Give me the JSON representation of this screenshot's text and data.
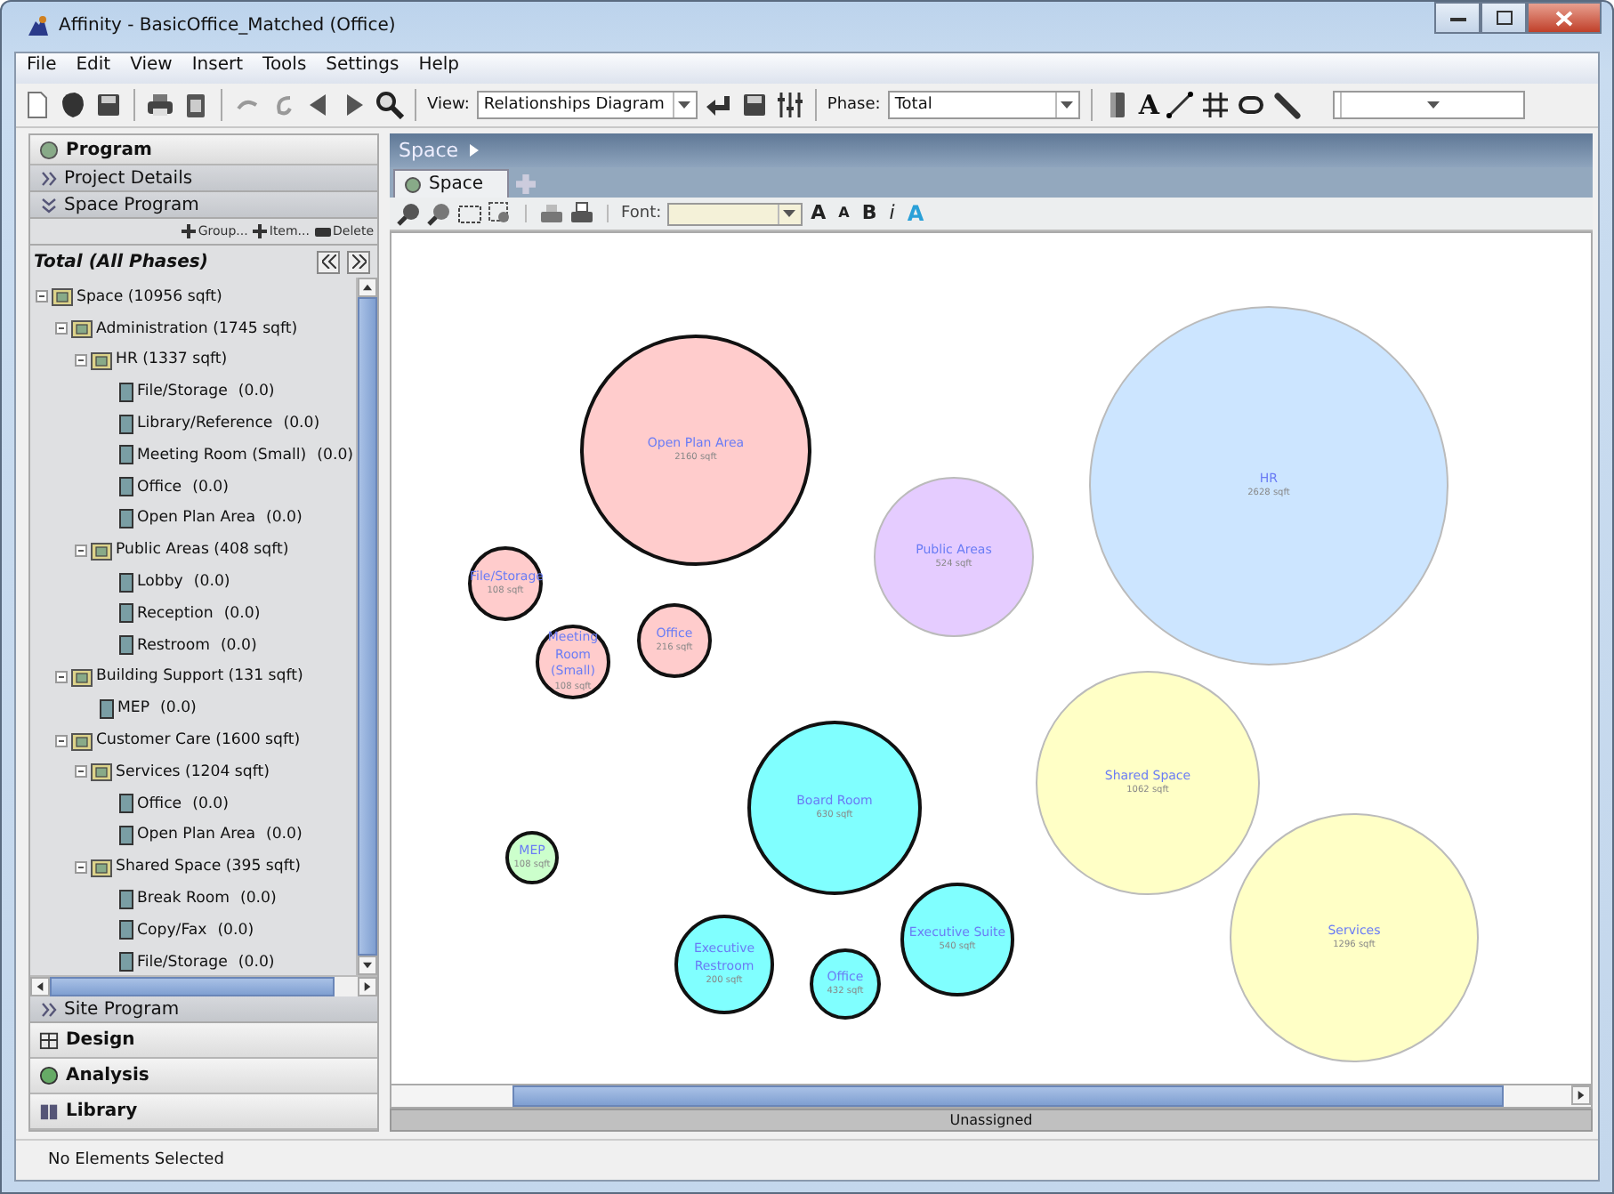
{
  "window": {
    "title": "Affinity - BasicOffice_Matched (Office)"
  },
  "menu": [
    "File",
    "Edit",
    "View",
    "Insert",
    "Tools",
    "Settings",
    "Help"
  ],
  "toolbar": {
    "view_label": "View:",
    "view_value": "Relationships Diagram",
    "phase_label": "Phase:",
    "phase_value": "Total",
    "text_tool": "A"
  },
  "program_panel": {
    "title": "Program",
    "subsections": [
      {
        "title": "Project Details",
        "expanded": false
      },
      {
        "title": "Space Program",
        "expanded": true
      }
    ],
    "actions": [
      "Group...",
      "Item...",
      "Delete"
    ],
    "filter_title": "Total (All Phases)",
    "tree": [
      {
        "label": "Space (10956 sqft)",
        "kind": "group",
        "expanded": true,
        "children": [
          {
            "label": "Administration (1745 sqft)",
            "kind": "group",
            "expanded": true,
            "children": [
              {
                "label": "HR (1337 sqft)",
                "kind": "group",
                "expanded": true,
                "children": [
                  {
                    "label": "File/Storage",
                    "value": "(0.0)",
                    "kind": "space"
                  },
                  {
                    "label": "Library/Reference",
                    "value": "(0.0)",
                    "kind": "space"
                  },
                  {
                    "label": "Meeting Room (Small)",
                    "value": "(0.0)",
                    "kind": "space"
                  },
                  {
                    "label": "Office",
                    "value": "(0.0)",
                    "kind": "space"
                  },
                  {
                    "label": "Open Plan Area",
                    "value": "(0.0)",
                    "kind": "space"
                  }
                ]
              },
              {
                "label": "Public Areas (408 sqft)",
                "kind": "group",
                "expanded": true,
                "children": [
                  {
                    "label": "Lobby",
                    "value": "(0.0)",
                    "kind": "space"
                  },
                  {
                    "label": "Reception",
                    "value": "(0.0)",
                    "kind": "space"
                  },
                  {
                    "label": "Restroom",
                    "value": "(0.0)",
                    "kind": "space"
                  }
                ]
              }
            ]
          },
          {
            "label": "Building Support (131 sqft)",
            "kind": "group",
            "expanded": true,
            "children": [
              {
                "label": "MEP",
                "value": "(0.0)",
                "kind": "space"
              }
            ]
          },
          {
            "label": "Customer Care (1600 sqft)",
            "kind": "group",
            "expanded": true,
            "children": [
              {
                "label": "Services (1204 sqft)",
                "kind": "group",
                "expanded": true,
                "children": [
                  {
                    "label": "Office",
                    "value": "(0.0)",
                    "kind": "space"
                  },
                  {
                    "label": "Open Plan Area",
                    "value": "(0.0)",
                    "kind": "space"
                  }
                ]
              },
              {
                "label": "Shared Space (395 sqft)",
                "kind": "group",
                "expanded": true,
                "children": [
                  {
                    "label": "Break Room",
                    "value": "(0.0)",
                    "kind": "space"
                  },
                  {
                    "label": "Copy/Fax",
                    "value": "(0.0)",
                    "kind": "space"
                  },
                  {
                    "label": "File/Storage",
                    "value": "(0.0)",
                    "kind": "space"
                  }
                ]
              }
            ]
          }
        ]
      }
    ],
    "site_program": {
      "title": "Site Program",
      "expanded": false
    }
  },
  "panels": [
    {
      "title": "Design"
    },
    {
      "title": "Analysis"
    },
    {
      "title": "Library"
    }
  ],
  "diagram": {
    "breadcrumb": "Space",
    "tabs": [
      {
        "label": "Space",
        "selected": true
      }
    ],
    "font_label": "Font:",
    "format_buttons": [
      {
        "label": "A",
        "kind": "grow"
      },
      {
        "label": "A",
        "kind": "shrink"
      },
      {
        "label": "B",
        "kind": "bold"
      },
      {
        "label": "i",
        "kind": "italic"
      },
      {
        "label": "A",
        "kind": "color"
      }
    ],
    "bubbles": [
      {
        "name": "Open Plan Area",
        "area": "2160 sqft",
        "color": "#ffcccc",
        "outlined": true
      },
      {
        "name": "File/Storage",
        "area": "108 sqft",
        "color": "#ffcccc",
        "outlined": true
      },
      {
        "name": "Meeting Room (Small)",
        "area": "108 sqft",
        "color": "#ffcccc",
        "outlined": true
      },
      {
        "name": "Office",
        "area": "216 sqft",
        "color": "#ffcccc",
        "outlined": true
      },
      {
        "name": "Public Areas",
        "area": "524 sqft",
        "color": "#e5ccff",
        "outlined": false
      },
      {
        "name": "HR",
        "area": "2628 sqft",
        "color": "#cce5ff",
        "outlined": false
      },
      {
        "name": "Shared Space",
        "area": "1062 sqft",
        "color": "#ffffc6",
        "outlined": false
      },
      {
        "name": "Board Room",
        "area": "630 sqft",
        "color": "#80ffff",
        "outlined": true
      },
      {
        "name": "MEP",
        "area": "108 sqft",
        "color": "#ccffcc",
        "outlined": true
      },
      {
        "name": "Executive Suite",
        "area": "540 sqft",
        "color": "#80ffff",
        "outlined": true
      },
      {
        "name": "Services",
        "area": "1296 sqft",
        "color": "#ffffc6",
        "outlined": false
      },
      {
        "name": "Executive Restroom",
        "area": "200 sqft",
        "color": "#80ffff",
        "outlined": true
      },
      {
        "name": "Office",
        "area": "432 sqft",
        "color": "#80ffff",
        "outlined": true
      }
    ],
    "footer": "Unassigned"
  },
  "status_bar": "No Elements Selected"
}
